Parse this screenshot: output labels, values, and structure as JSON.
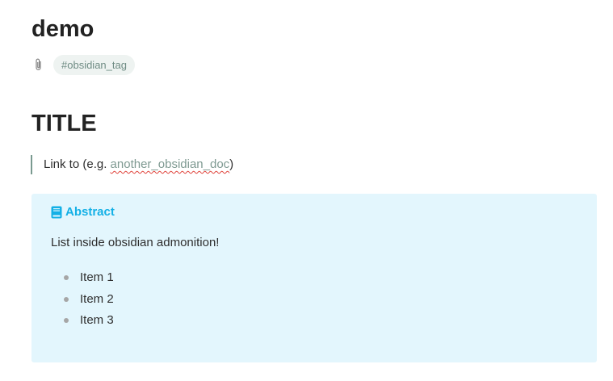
{
  "page": {
    "title": "demo",
    "tag": "#obsidian_tag",
    "attachment_icon": "paperclip-icon"
  },
  "content": {
    "heading": "TITLE",
    "quote": {
      "prefix": "Link to (e.g. ",
      "link_text": "another_obsidian_doc",
      "suffix": ")"
    },
    "admonition": {
      "icon": "book-icon",
      "title": "Abstract",
      "body": "List inside obsidian admonition!",
      "items": [
        "Item 1",
        "Item 2",
        "Item 3"
      ]
    }
  },
  "colors": {
    "admonition_bg": "#e3f6fd",
    "admonition_accent": "#14b0e6",
    "tag_bg": "#eef3f1",
    "tag_text": "#6f8c84",
    "link_text": "#7f9a92",
    "spellcheck_underline": "#e0443c"
  }
}
